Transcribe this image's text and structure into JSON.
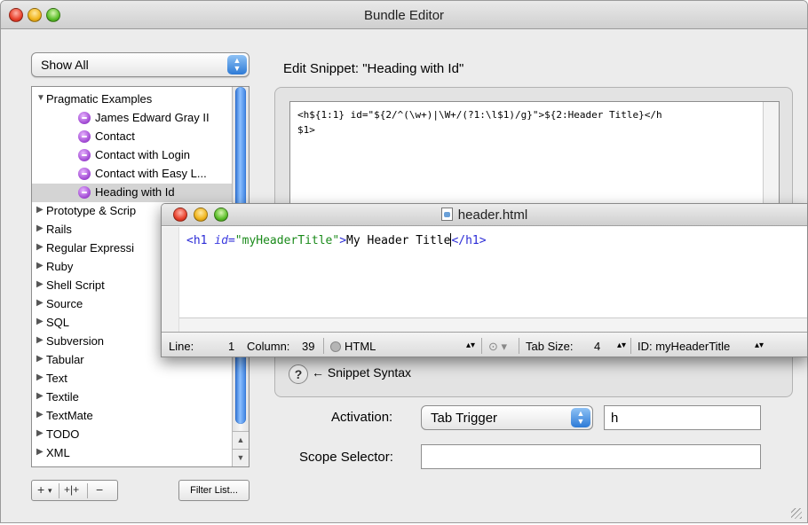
{
  "window": {
    "title": "Bundle Editor"
  },
  "filter_popup": {
    "label": "Show All"
  },
  "outline": {
    "items": [
      {
        "label": "Pragmatic Examples",
        "expanded": true,
        "level": 0
      },
      {
        "label": "James Edward Gray II",
        "level": 1,
        "icon": "snippet-icon"
      },
      {
        "label": "Contact",
        "level": 1,
        "icon": "snippet-icon"
      },
      {
        "label": "Contact with Login",
        "level": 1,
        "icon": "snippet-icon"
      },
      {
        "label": "Contact with Easy L...",
        "level": 1,
        "icon": "snippet-icon"
      },
      {
        "label": "Heading with Id",
        "level": 1,
        "icon": "snippet-icon",
        "selected": true
      },
      {
        "label": "Prototype & Scrip",
        "level": 0
      },
      {
        "label": "Rails",
        "level": 0
      },
      {
        "label": "Regular Expressi",
        "level": 0
      },
      {
        "label": "Ruby",
        "level": 0
      },
      {
        "label": "Shell Script",
        "level": 0
      },
      {
        "label": "Source",
        "level": 0
      },
      {
        "label": "SQL",
        "level": 0
      },
      {
        "label": "Subversion",
        "level": 0
      },
      {
        "label": "Tabular",
        "level": 0
      },
      {
        "label": "Text",
        "level": 0
      },
      {
        "label": "Textile",
        "level": 0
      },
      {
        "label": "TextMate",
        "level": 0
      },
      {
        "label": "TODO",
        "level": 0
      },
      {
        "label": "XML",
        "level": 0
      }
    ]
  },
  "bottom_buttons": {
    "add": "+",
    "add_menu": "▾",
    "add_group": "+|+",
    "remove": "−",
    "filter": "Filter List..."
  },
  "editor": {
    "label": "Edit Snippet: \"Heading with Id\"",
    "snippet_lines": [
      "<h${1:1} id=\"${2/^(\\w+)|\\W+/(?1:\\l$1)/g}\">${2:Header Title}</h",
      "$1>"
    ],
    "syntax_label": "← Snippet Syntax",
    "help_label": "?"
  },
  "activation": {
    "label": "Activation:",
    "value": "Tab Trigger",
    "trigger": "h",
    "scope_label": "Scope Selector:",
    "scope_value": ""
  },
  "doc_window": {
    "title": "header.html",
    "code": {
      "open_tag": "<h1 ",
      "attr": "id",
      "eq": "=",
      "str": "\"myHeaderTitle\"",
      "gt": ">",
      "text": "My Header Title",
      "close_tag": "</h1>"
    },
    "status": {
      "line_label": "Line:",
      "line": "1",
      "column_label": "Column:",
      "column": "39",
      "language": "HTML",
      "tab_size_label": "Tab Size:",
      "tab_size": "4",
      "symbol": "ID: myHeaderTitle"
    }
  }
}
